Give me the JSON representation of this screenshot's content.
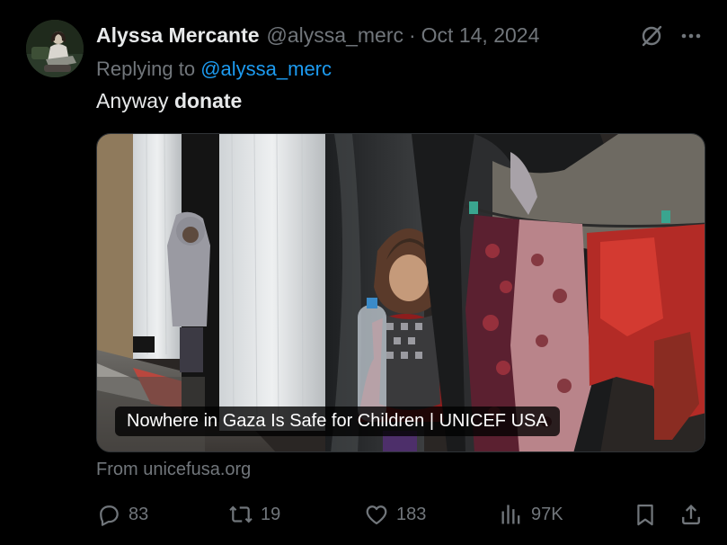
{
  "author": {
    "name": "Alyssa Mercante",
    "handle": "@alyssa_merc",
    "separator": "·",
    "date": "Oct 14, 2024"
  },
  "reply": {
    "prefix": "Replying to ",
    "mention": "@alyssa_merc"
  },
  "body": {
    "plain": "Anyway ",
    "bold": "donate"
  },
  "card": {
    "caption": "Nowhere in Gaza Is Safe for Children | UNICEF USA",
    "source": "From unicefusa.org"
  },
  "actions": {
    "replies": "83",
    "reposts": "19",
    "likes": "183",
    "views": "97K"
  },
  "icons": [
    "grok-icon",
    "more-icon",
    "reply-icon",
    "repost-icon",
    "like-icon",
    "views-icon",
    "bookmark-icon",
    "share-icon"
  ],
  "colors": {
    "background": "#000000",
    "text": "#e7e9ea",
    "muted": "#71767b",
    "link": "#1d9bf0"
  }
}
